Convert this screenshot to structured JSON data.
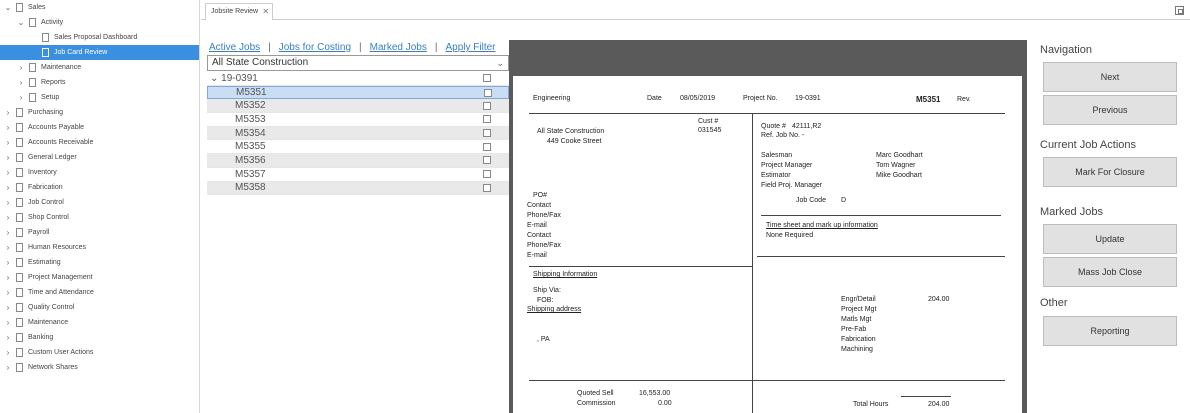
{
  "sidebar": {
    "items": [
      {
        "label": "Sales",
        "indent": 0,
        "chev": "⌄"
      },
      {
        "label": "Activity",
        "indent": 1,
        "chev": "⌄"
      },
      {
        "label": "Sales Proposal Dashboard",
        "indent": 2,
        "chev": ""
      },
      {
        "label": "Job Card Review",
        "indent": 2,
        "chev": "",
        "selected": true
      },
      {
        "label": "Maintenance",
        "indent": 1,
        "chev": "›"
      },
      {
        "label": "Reports",
        "indent": 1,
        "chev": "›"
      },
      {
        "label": "Setup",
        "indent": 1,
        "chev": "›"
      },
      {
        "label": "Purchasing",
        "indent": 0,
        "chev": "›"
      },
      {
        "label": "Accounts Payable",
        "indent": 0,
        "chev": "›"
      },
      {
        "label": "Accounts Receivable",
        "indent": 0,
        "chev": "›"
      },
      {
        "label": "General Ledger",
        "indent": 0,
        "chev": "›"
      },
      {
        "label": "Inventory",
        "indent": 0,
        "chev": "›"
      },
      {
        "label": "Fabrication",
        "indent": 0,
        "chev": "›"
      },
      {
        "label": "Job Control",
        "indent": 0,
        "chev": "›"
      },
      {
        "label": "Shop Control",
        "indent": 0,
        "chev": "›"
      },
      {
        "label": "Payroll",
        "indent": 0,
        "chev": "›"
      },
      {
        "label": "Human Resources",
        "indent": 0,
        "chev": "›"
      },
      {
        "label": "Estimating",
        "indent": 0,
        "chev": "›"
      },
      {
        "label": "Project Management",
        "indent": 0,
        "chev": "›"
      },
      {
        "label": "Time and Attendance",
        "indent": 0,
        "chev": "›"
      },
      {
        "label": "Quality Control",
        "indent": 0,
        "chev": "›"
      },
      {
        "label": "Maintenance",
        "indent": 0,
        "chev": "›"
      },
      {
        "label": "Banking",
        "indent": 0,
        "chev": "›"
      },
      {
        "label": "Custom User Actions",
        "indent": 0,
        "chev": "›"
      },
      {
        "label": "Network Shares",
        "indent": 0,
        "chev": "›"
      }
    ]
  },
  "tab": {
    "label": "Jobsite Review",
    "close": "✕"
  },
  "links": {
    "active_jobs": "Active Jobs",
    "jobs_for_costing": "Jobs for Costing",
    "marked_jobs": "Marked Jobs",
    "apply_filter": "Apply Filter",
    "separator": "|"
  },
  "filter": {
    "value": "All State Construction",
    "chev": "⌄"
  },
  "jobs": {
    "group": {
      "label": "19-0391",
      "chev": "⌄"
    },
    "rows": [
      "M5351",
      "M5352",
      "M5353",
      "M5354",
      "M5355",
      "M5356",
      "M5357",
      "M5358"
    ]
  },
  "report": {
    "department": "Engineering",
    "date_label": "Date",
    "date": "08/05/2019",
    "project_label": "Project No.",
    "project_no": "19-0391",
    "job_no": "M5351",
    "rev_label": "Rev.",
    "customer": "All State Construction",
    "address": "449 Cooke Street",
    "cust_label": "Cust #",
    "cust_no": "031545",
    "quote_label": "Quote #",
    "quote_no": "42111,R2",
    "ref_job": "Ref. Job No. -",
    "roles": [
      "Salesman",
      "Project Manager",
      "Estimator",
      "Field Proj. Manager"
    ],
    "people": [
      "Marc Goodhart",
      "Tom Wagner",
      "Mike Goodhart"
    ],
    "job_code_label": "Job Code",
    "job_code": "D",
    "contact_labels": [
      "PO#",
      "Contact",
      "Phone/Fax",
      "E-mail",
      "Contact",
      "Phone/Fax",
      "E-mail"
    ],
    "timesheet_label": "Time sheet and mark up information",
    "timesheet_value": "None Required",
    "shipping_info": "Shipping Information",
    "ship_via": "Ship Via:",
    "fob": "FOB:",
    "shipping_address": "Shipping address",
    "pa": ", PA",
    "hours_labels": [
      "Engr/Detail",
      "Project Mgt",
      "Matls Mgt",
      "Pre-Fab",
      "Fabrication",
      "Machining"
    ],
    "engr_hours": "204.00",
    "quoted_sell_label": "Quoted Sell",
    "quoted_sell": "16,553.00",
    "commission_label": "Commission",
    "commission": "0.00",
    "total_hours_label": "Total Hours",
    "total_hours": "204.00"
  },
  "right_panel": {
    "navigation": "Navigation",
    "next": "Next",
    "previous": "Previous",
    "current_job_actions": "Current Job Actions",
    "mark_for_closure": "Mark For Closure",
    "marked_jobs": "Marked Jobs",
    "update": "Update",
    "mass_job_close": "Mass Job Close",
    "other": "Other",
    "reporting": "Reporting"
  }
}
